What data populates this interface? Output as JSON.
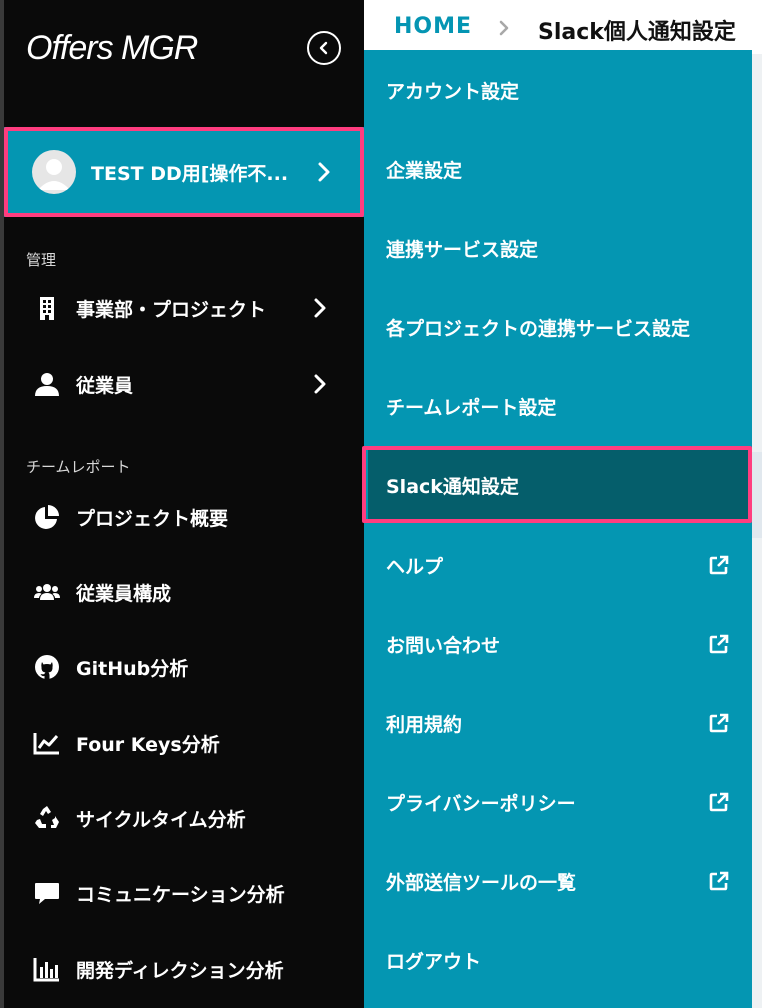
{
  "app": {
    "logo": "Offers MGR"
  },
  "user": {
    "name": "TEST DD用[操作不..."
  },
  "breadcrumb": {
    "home": "HOME",
    "current": "Slack個人通知設定"
  },
  "sidebar": {
    "sections": [
      {
        "label": "管理",
        "items": [
          {
            "label": "事業部・プロジェクト",
            "icon": "building-icon",
            "has_chevron": true
          },
          {
            "label": "従業員",
            "icon": "person-icon",
            "has_chevron": true
          }
        ]
      },
      {
        "label": "チームレポート",
        "items": [
          {
            "label": "プロジェクト概要",
            "icon": "pie-chart-icon"
          },
          {
            "label": "従業員構成",
            "icon": "users-icon"
          },
          {
            "label": "GitHub分析",
            "icon": "github-icon"
          },
          {
            "label": "Four Keys分析",
            "icon": "line-chart-icon"
          },
          {
            "label": "サイクルタイム分析",
            "icon": "recycle-icon"
          },
          {
            "label": "コミュニケーション分析",
            "icon": "comment-icon"
          },
          {
            "label": "開発ディレクション分析",
            "icon": "bar-chart-icon"
          }
        ]
      }
    ]
  },
  "menu": {
    "items": [
      {
        "label": "アカウント設定"
      },
      {
        "label": "企業設定"
      },
      {
        "label": "連携サービス設定"
      },
      {
        "label": "各プロジェクトの連携サービス設定"
      },
      {
        "label": "チームレポート設定"
      },
      {
        "label": "Slack通知設定",
        "active": true
      },
      {
        "label": "ヘルプ",
        "external": true
      },
      {
        "label": "お問い合わせ",
        "external": true
      },
      {
        "label": "利用規約",
        "external": true
      },
      {
        "label": "プライバシーポリシー",
        "external": true
      },
      {
        "label": "外部送信ツールの一覧",
        "external": true
      },
      {
        "label": "ログアウト"
      }
    ]
  },
  "colors": {
    "sidebar_bg": "#0a0a0a",
    "accent": "#0496b2",
    "menu_active": "#055e6b",
    "highlight": "#ff3d7f",
    "breadcrumb_home": "#0495b3"
  }
}
